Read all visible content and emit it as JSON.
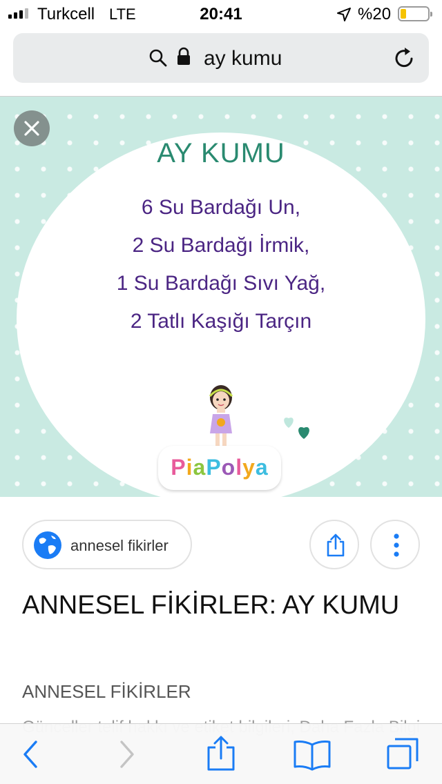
{
  "status_bar": {
    "carrier": "Turkcell",
    "network": "LTE",
    "time": "20:41",
    "battery_percent": "%20",
    "battery_level": 0.2,
    "signal_bars_filled": 3,
    "signal_bars_total": 4,
    "battery_color": "#f5c200"
  },
  "address_bar": {
    "text": "ay kumu",
    "icons": [
      "search-icon",
      "lock-icon",
      "reload-icon"
    ]
  },
  "image": {
    "title": "AY KUMU",
    "lines": [
      "6 Su Bardağı Un,",
      "2 Su Bardağı İrmik,",
      "1 Su Bardağı Sıvı Yağ,",
      "2 Tatlı Kaşığı Tarçın"
    ],
    "brand_letters": [
      "P",
      "i",
      "a",
      "P",
      "o",
      "l",
      "y",
      "a"
    ],
    "brand_colors": [
      "#e85b9b",
      "#f2a81d",
      "#8cc63f",
      "#3dbde0",
      "#9b59b6",
      "#e85b9b",
      "#f2a81d",
      "#3dbde0"
    ],
    "title_color": "#2a8a70",
    "text_color": "#4b2583",
    "background_color": "#c9eae2"
  },
  "result": {
    "source_chip": "annesel fikirler",
    "title": "ANNESEL FİKİRLER: AY KUMU",
    "source": "ANNESEL FİKİRLER",
    "snippet": "Günceller telif hakkı ve etiket bilgileri, Daha Fazla Bilgi"
  },
  "toolbar": {
    "buttons": [
      "back-icon",
      "forward-icon",
      "share-icon",
      "bookmarks-icon",
      "tabs-icon"
    ],
    "accent_color": "#1a7cf5"
  }
}
